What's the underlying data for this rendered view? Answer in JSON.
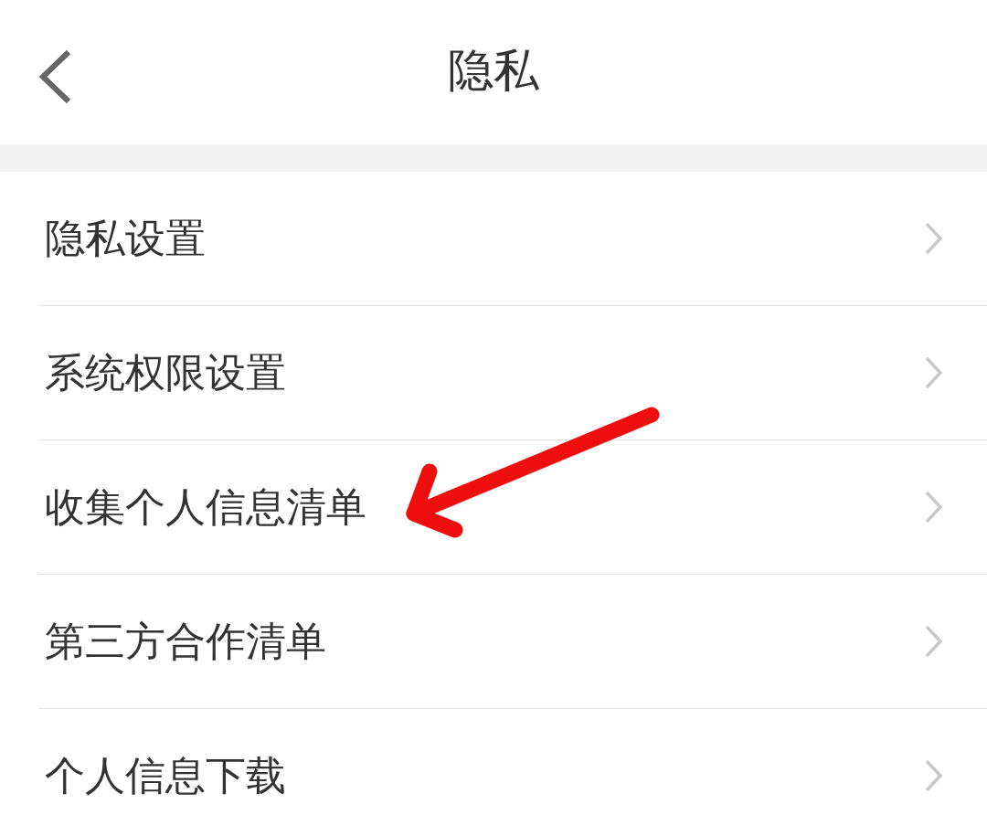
{
  "header": {
    "title": "隐私"
  },
  "items": [
    {
      "label": "隐私设置",
      "marked": false
    },
    {
      "label": "系统权限设置",
      "marked": false
    },
    {
      "label": "收集个人信息清单",
      "marked": true
    },
    {
      "label": "第三方合作清单",
      "marked": false
    },
    {
      "label": "个人信息下载",
      "marked": false
    }
  ]
}
